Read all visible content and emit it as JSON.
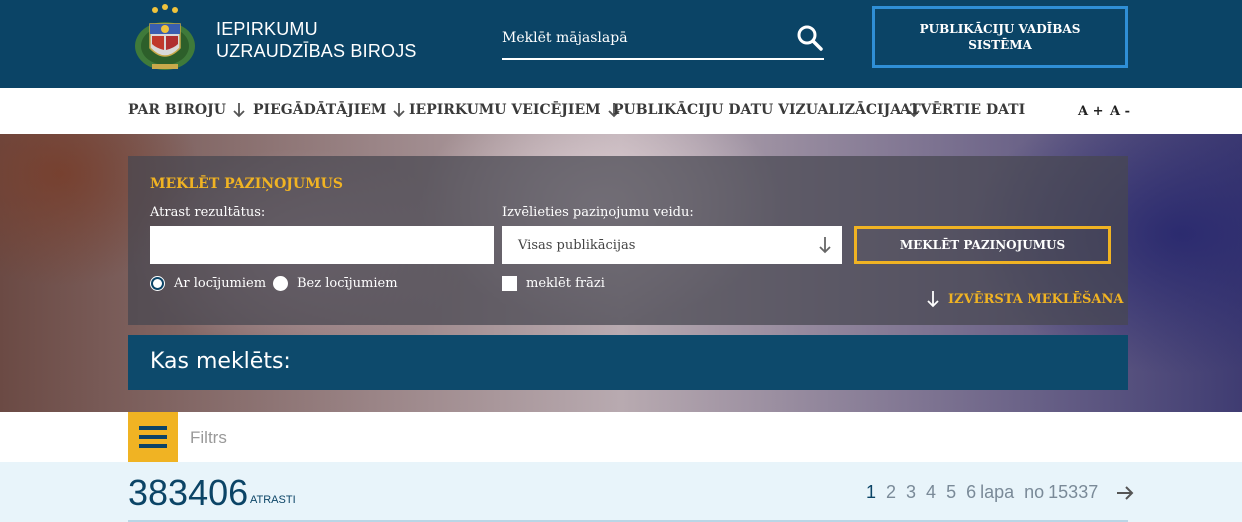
{
  "header": {
    "org_name_line1": "IEPIRKUMU",
    "org_name_line2": "UZRAUDZĪBAS BIROJS",
    "logo_icon": "coat-of-arms-icon",
    "site_search_placeholder": "Meklēt mājaslapā",
    "search_icon": "search-icon",
    "publication_button": "PUBLIKĀCIJU VADĪBAS SISTĒMA"
  },
  "nav": {
    "items": [
      {
        "label": "PAR BIROJU",
        "has_arrow": true
      },
      {
        "label": "PIEGĀDĀTĀJIEM",
        "has_arrow": true
      },
      {
        "label": "IEPIRKUMU VEICĒJIEM",
        "has_arrow": true
      },
      {
        "label": "PUBLIKĀCIJU DATU VIZUALIZĀCIJA",
        "has_arrow": true
      },
      {
        "label": "ATVĒRTIE DATI",
        "has_arrow": false
      }
    ],
    "font_increase": "A +",
    "font_decrease": "A -"
  },
  "search_panel": {
    "title": "MEKLĒT PAZIŅOJUMUS",
    "query_label": "Atrast rezultātus:",
    "query_value": "",
    "type_label": "Izvēlieties paziņojumu veidu:",
    "type_value": "Visas publikācijas",
    "submit": "MEKLĒT PAZIŅOJUMUS",
    "radio_with_inflections": "Ar locījumiem",
    "radio_without_inflections": "Bez locījumiem",
    "radio_selected": "Ar locījumiem",
    "phrase_checkbox": "meklēt frāzi",
    "phrase_checked": false,
    "advanced_link": "IZVĒRSTA MEKLĒŠANA"
  },
  "searched": {
    "label": "Kas meklēts:"
  },
  "filter": {
    "icon": "hamburger-menu-icon",
    "label": "Filtrs"
  },
  "results": {
    "count": "383406",
    "count_label": "ATRASTI",
    "pages": [
      "1",
      "2",
      "3",
      "4",
      "5",
      "6"
    ],
    "current_page": "1",
    "page_word": "lapa",
    "of_word": "no",
    "total_pages": "15337",
    "next_icon": "arrow-right-icon"
  },
  "colors": {
    "header_bg": "#0b4466",
    "accent_yellow": "#f0b323",
    "accent_blue": "#2f8fd6",
    "results_bg": "#e8f4fa"
  }
}
